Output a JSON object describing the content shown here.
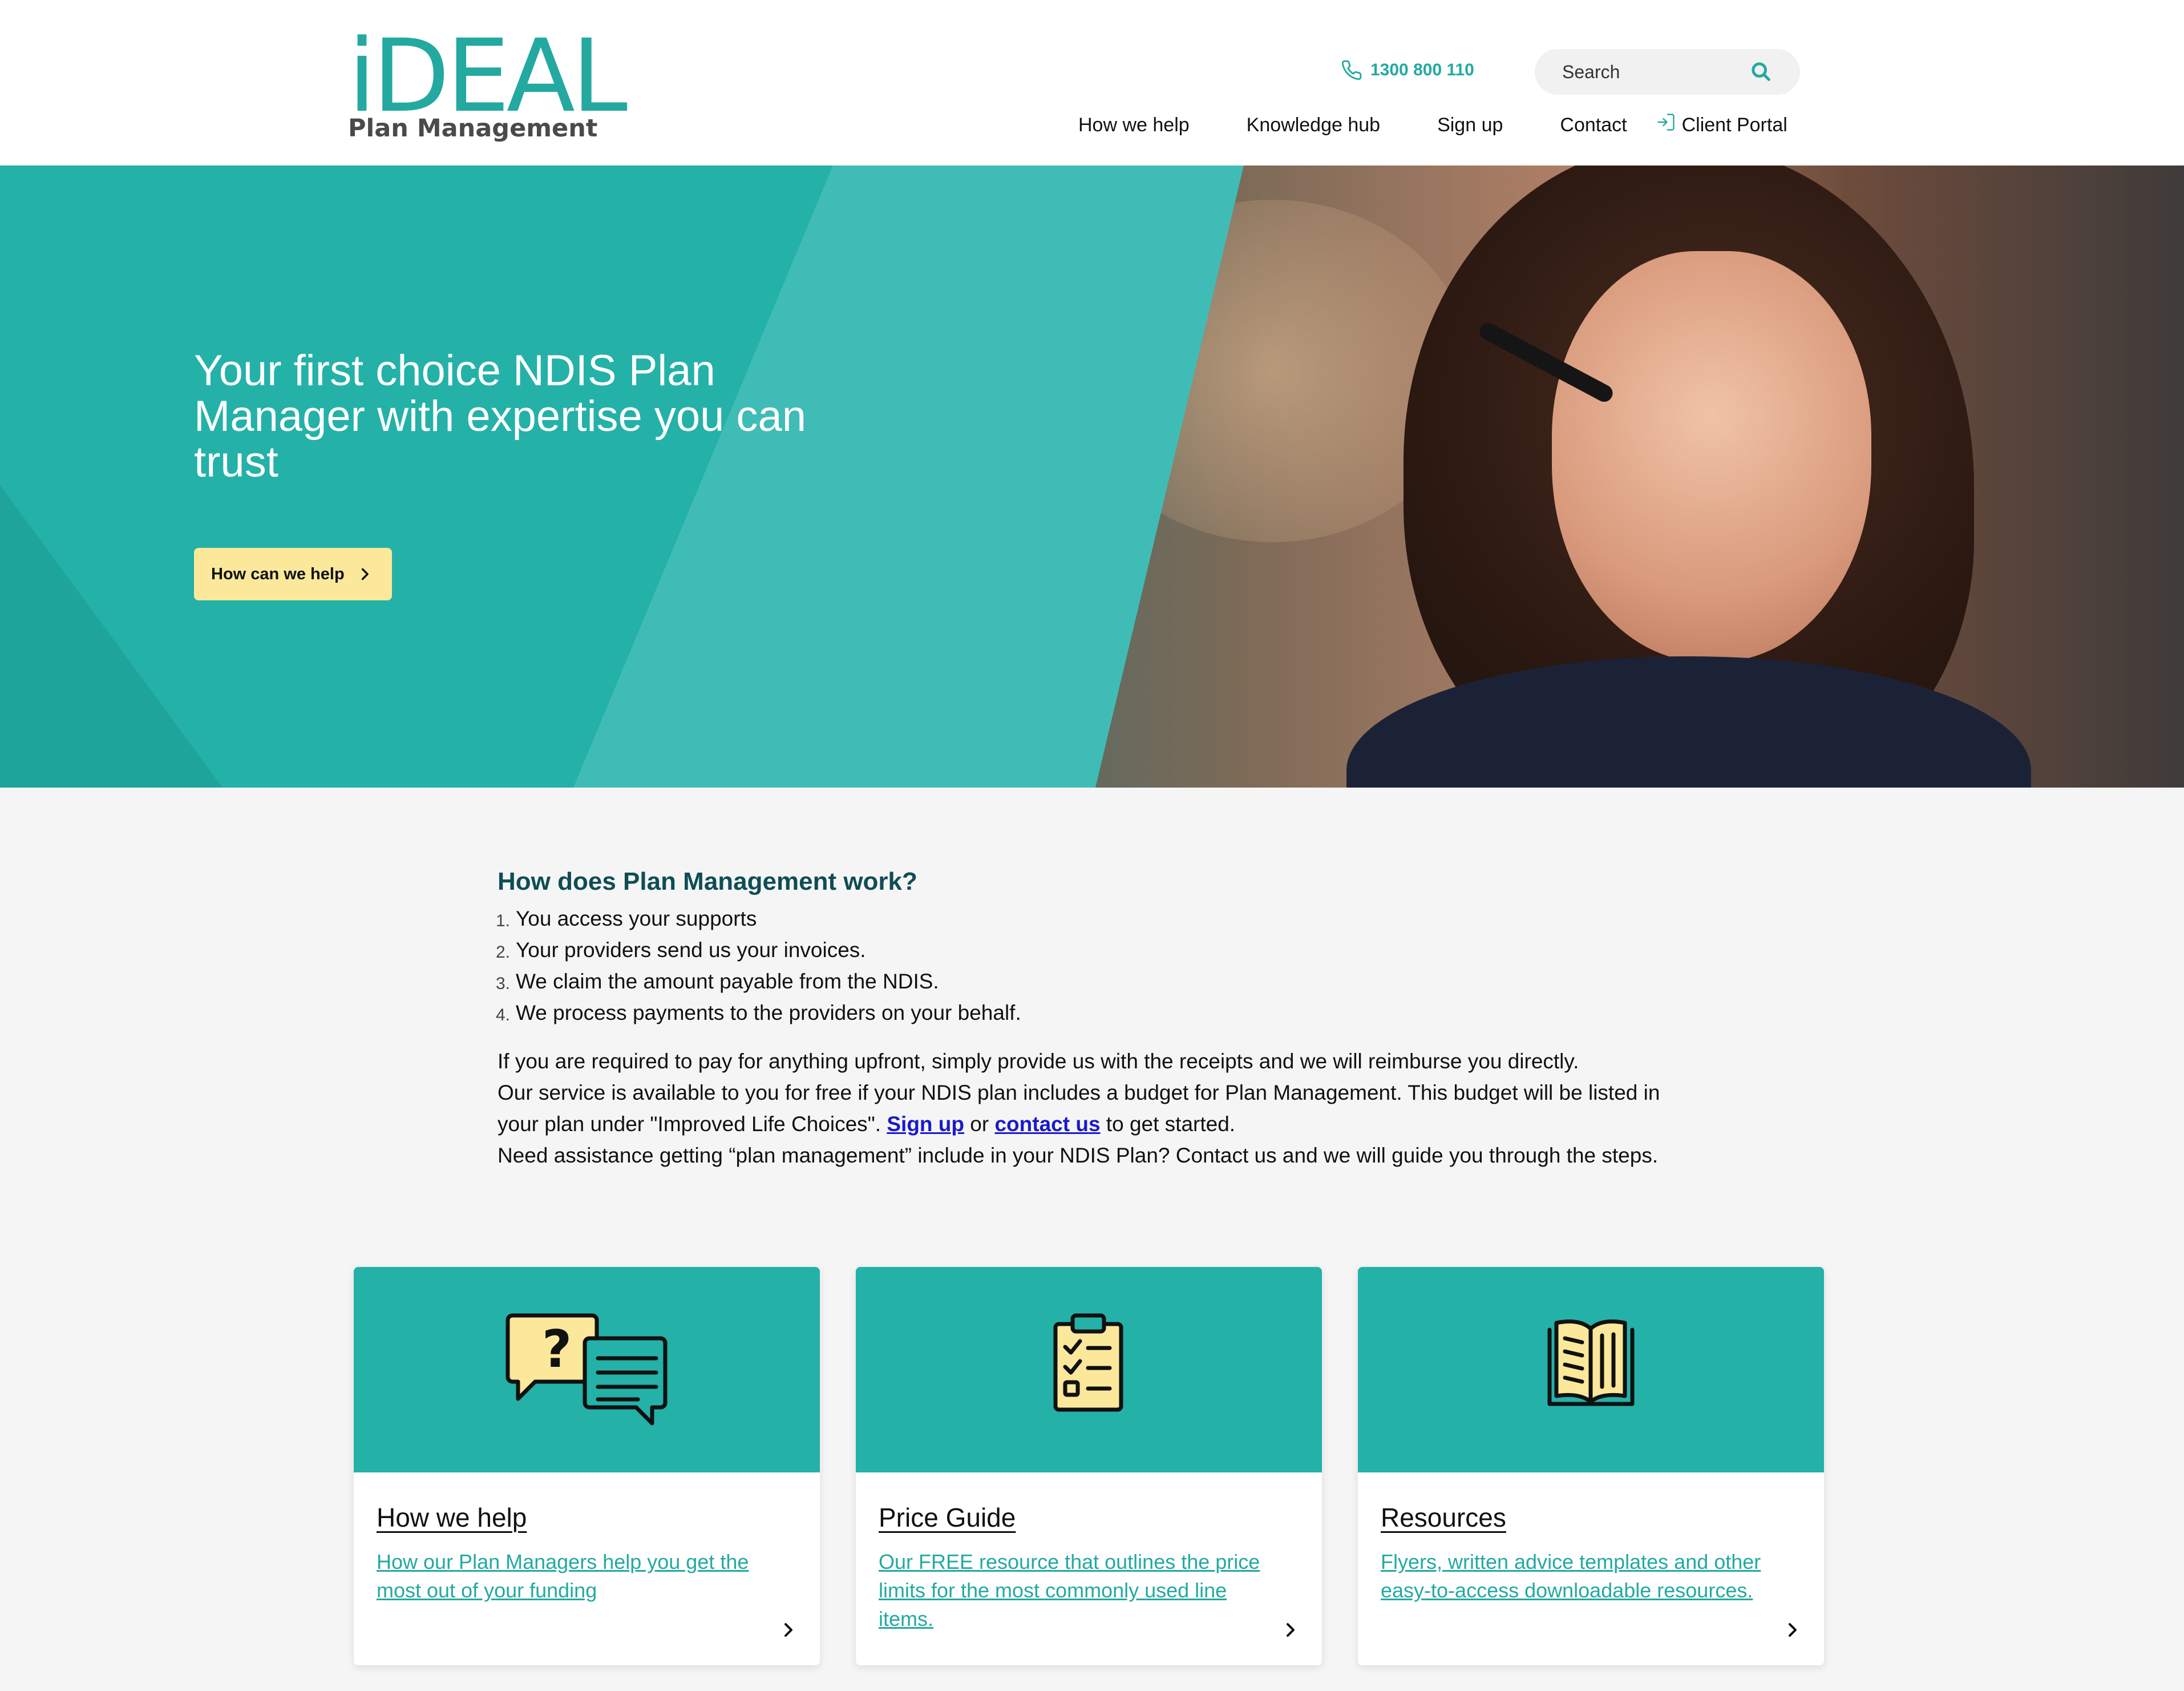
{
  "header": {
    "logo_main": "iDEAL",
    "logo_sub": "Plan Management",
    "phone": "1300 800 110",
    "search_placeholder": "Search",
    "nav": [
      "How we help",
      "Knowledge hub",
      "Sign up",
      "Contact"
    ],
    "client_portal": "Client Portal"
  },
  "hero": {
    "title": "Your first choice NDIS Plan Manager with expertise you can trust",
    "button_label": "How can we help"
  },
  "content": {
    "heading": "How does Plan Management work?",
    "steps": [
      {
        "num": "1.",
        "text": "You access your supports"
      },
      {
        "num": "2.",
        "text": "Your providers send us your invoices."
      },
      {
        "num": "3.",
        "text": "We claim the amount payable from the NDIS."
      },
      {
        "num": "4.",
        "text": "We process payments to the providers on your behalf."
      }
    ],
    "para1": "If you are required to pay for anything upfront, simply provide us with the receipts and we will reimburse you directly.",
    "para2_before": "Our service is available to you for free if your NDIS plan includes a budget for Plan Management. This budget will be listed in your plan under \"Improved Life Choices\". ",
    "signup_link": "Sign up",
    "para2_or": " or ",
    "contact_link": "contact us",
    "para2_after": " to get started.",
    "para3": "Need assistance getting “plan management” include in your NDIS Plan? Contact us and we will guide you through the steps."
  },
  "cards": [
    {
      "title": "How we help",
      "desc": "How our Plan Managers help you get the most out of your funding",
      "icon": "chat-question-icon"
    },
    {
      "title": "Price Guide",
      "desc": "Our FREE resource that outlines the price limits for the most commonly used line items.",
      "icon": "clipboard-checklist-icon"
    },
    {
      "title": "Resources",
      "desc": "Flyers, written advice templates and other easy-to-access downloadable resources.",
      "icon": "open-book-icon"
    }
  ],
  "colors": {
    "brand_teal": "#24b1a8",
    "heading_dark_teal": "#0f4d53",
    "button_yellow": "#fbe89b",
    "link_blue": "#1a1acc"
  }
}
